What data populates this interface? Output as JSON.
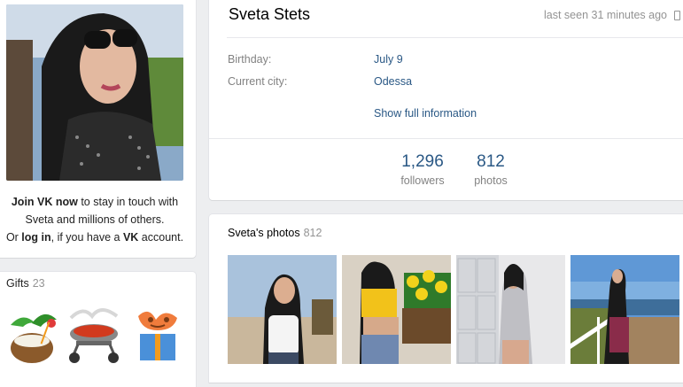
{
  "profile": {
    "name": "Sveta Stets",
    "last_seen": "last seen 31 minutes ago",
    "birthday_label": "Birthday:",
    "birthday": "July 9",
    "city_label": "Current city:",
    "city": "Odessa",
    "show_full_info": "Show full information",
    "counters": [
      {
        "value": "1,296",
        "label": "followers"
      },
      {
        "value": "812",
        "label": "photos"
      }
    ]
  },
  "join": {
    "join_link": "Join VK now",
    "line1_rest": " to stay in touch with",
    "line2": "Sveta and millions of others.",
    "or": "Or ",
    "login_link": "log in",
    "line3_mid": ", if you have a ",
    "vk": "VK",
    "line3_end": " account."
  },
  "gifts": {
    "title": "Gifts",
    "count": "23",
    "items": [
      "coconut-cocktail-icon",
      "grill-icon",
      "gift-box-icon"
    ]
  },
  "photos": {
    "title": "Sveta's photos",
    "count": "812"
  },
  "colors": {
    "link": "#2a5885",
    "muted": "#828282",
    "background": "#edeef0"
  }
}
